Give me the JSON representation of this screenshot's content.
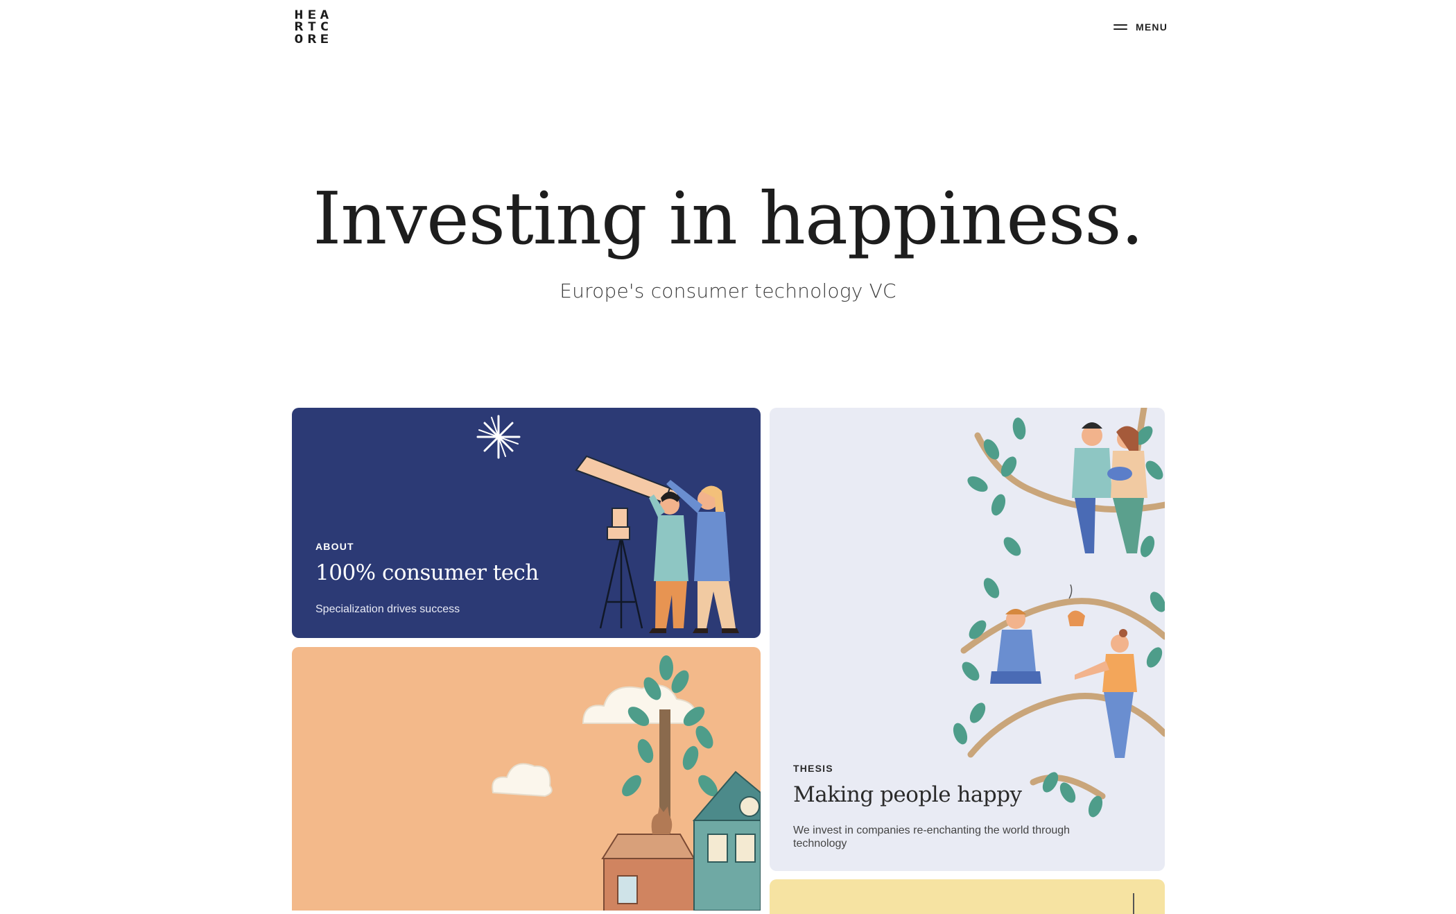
{
  "header": {
    "logo_letters": [
      "H",
      "E",
      "A",
      "R",
      "T",
      "C",
      "O",
      "R",
      "E"
    ],
    "menu_label": "MENU"
  },
  "hero": {
    "title": "Investing in happiness.",
    "subtitle": "Europe's consumer technology VC"
  },
  "cards": [
    {
      "eyebrow": "ABOUT",
      "title": "100% consumer tech",
      "description": "Specialization drives success",
      "background": "#2c3a75",
      "illustration": "telescope-stargazers"
    },
    {
      "eyebrow": "THESIS",
      "title": "Making people happy",
      "description": "We invest in companies re-enchanting the world through technology",
      "background": "#e9ebf4",
      "illustration": "family-in-tree"
    },
    {
      "background": "#f3b98a",
      "illustration": "house-tree-clouds"
    },
    {
      "background": "#f6e3a2",
      "illustration": "partial-card"
    }
  ]
}
